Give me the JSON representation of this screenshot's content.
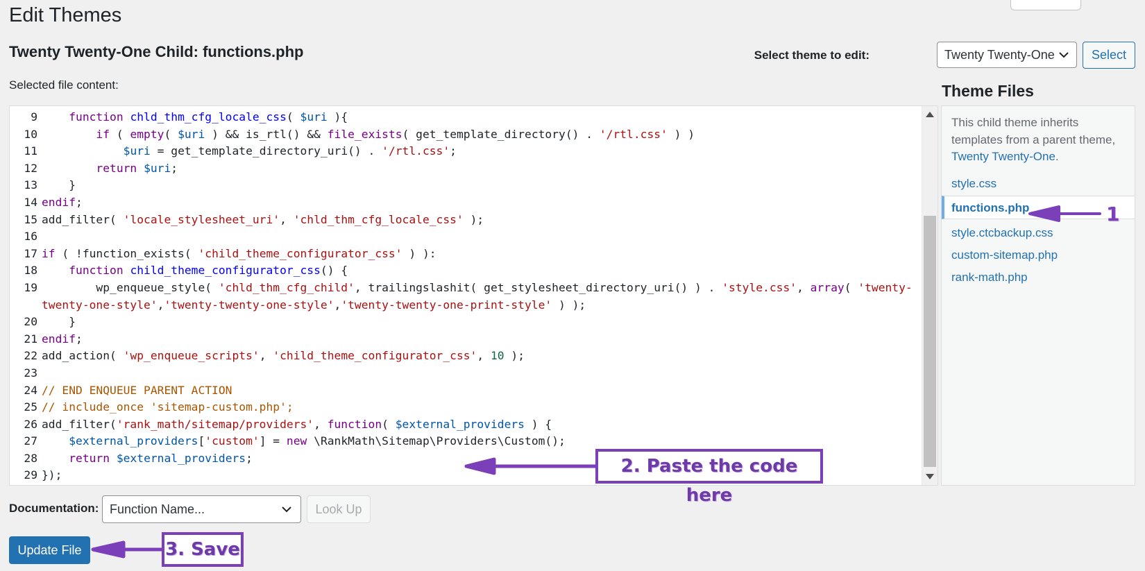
{
  "page_title": "Edit Themes",
  "file_title": "Twenty Twenty-One Child: functions.php",
  "select_theme": {
    "label": "Select theme to edit:",
    "value": "Twenty Twenty-One",
    "button": "Select"
  },
  "content_label": "Selected file content:",
  "code_lines": [
    {
      "num": "9",
      "html": "    <span class='k'>function</span> <span class='d'>chld_thm_cfg_locale_css</span>( <span class='v'>$uri</span> ){"
    },
    {
      "num": "10",
      "html": "        <span class='k'>if</span> ( <span class='k'>empty</span>( <span class='v'>$uri</span> ) &amp;&amp; is_rtl() &amp;&amp; <span class='k'>file_exists</span>( get_template_directory() . <span class='s'>'/rtl.css'</span> ) )"
    },
    {
      "num": "11",
      "html": "            <span class='v'>$uri</span> = get_template_directory_uri() . <span class='s'>'/rtl.css'</span>;"
    },
    {
      "num": "12",
      "html": "        <span class='k'>return</span> <span class='v'>$uri</span>;"
    },
    {
      "num": "13",
      "html": "    }"
    },
    {
      "num": "14",
      "html": "<span class='k'>endif</span>;"
    },
    {
      "num": "15",
      "html": "add_filter( <span class='s'>'locale_stylesheet_uri'</span>, <span class='s'>'chld_thm_cfg_locale_css'</span> );"
    },
    {
      "num": "16",
      "html": ""
    },
    {
      "num": "17",
      "html": "<span class='k'>if</span> ( !function_exists( <span class='s'>'child_theme_configurator_css'</span> ) ):"
    },
    {
      "num": "18",
      "html": "    <span class='k'>function</span> <span class='d'>child_theme_configurator_css</span>() {"
    },
    {
      "num": "19",
      "html": "        wp_enqueue_style( <span class='s'>'chld_thm_cfg_child'</span>, trailingslashit( get_stylesheet_directory_uri() ) . <span class='s'>'style.css'</span>, <span class='k'>array</span>( <span class='s'>'twenty-</span>"
    },
    {
      "num": "",
      "html": "<span class='s'>twenty-one-style'</span>,<span class='s'>'twenty-twenty-one-style'</span>,<span class='s'>'twenty-twenty-one-print-style'</span> ) );"
    },
    {
      "num": "20",
      "html": "    }"
    },
    {
      "num": "21",
      "html": "<span class='k'>endif</span>;"
    },
    {
      "num": "22",
      "html": "add_action( <span class='s'>'wp_enqueue_scripts'</span>, <span class='s'>'child_theme_configurator_css'</span>, <span class='n'>10</span> );"
    },
    {
      "num": "23",
      "html": ""
    },
    {
      "num": "24",
      "html": "<span class='c'>// END ENQUEUE PARENT ACTION</span>"
    },
    {
      "num": "25",
      "html": "<span class='c'>// include_once 'sitemap-custom.php';</span>"
    },
    {
      "num": "26",
      "html": "add_filter(<span class='s'>'rank_math/sitemap/providers'</span>, <span class='k'>function</span>( <span class='v'>$external_providers</span> ) {"
    },
    {
      "num": "27",
      "html": "    <span class='v'>$external_providers</span>[<span class='s'>'custom'</span>] = <span class='k'>new</span> \\RankMath\\Sitemap\\Providers\\Custom();"
    },
    {
      "num": "28",
      "html": "    <span class='k'>return</span> <span class='v'>$external_providers</span>;"
    },
    {
      "num": "29",
      "html": "});"
    }
  ],
  "theme_files": {
    "title": "Theme Files",
    "note_prefix": "This child theme inherits templates from a parent theme, ",
    "note_link": "Twenty Twenty-One",
    "note_suffix": ".",
    "files": [
      {
        "name": "style.css",
        "active": false
      },
      {
        "name": "functions.php",
        "active": true
      },
      {
        "name": "style.ctcbackup.css",
        "active": false
      },
      {
        "name": "custom-sitemap.php",
        "active": false
      },
      {
        "name": "rank-math.php",
        "active": false
      }
    ]
  },
  "documentation": {
    "label": "Documentation:",
    "placeholder": "Function Name...",
    "button": "Look Up"
  },
  "update_button": "Update File",
  "annotations": {
    "step1": "1",
    "step2": "2. Paste the code here",
    "step3": "3. Save"
  },
  "colors": {
    "accent": "#2271b1",
    "annotation": "#7b3fb9"
  }
}
